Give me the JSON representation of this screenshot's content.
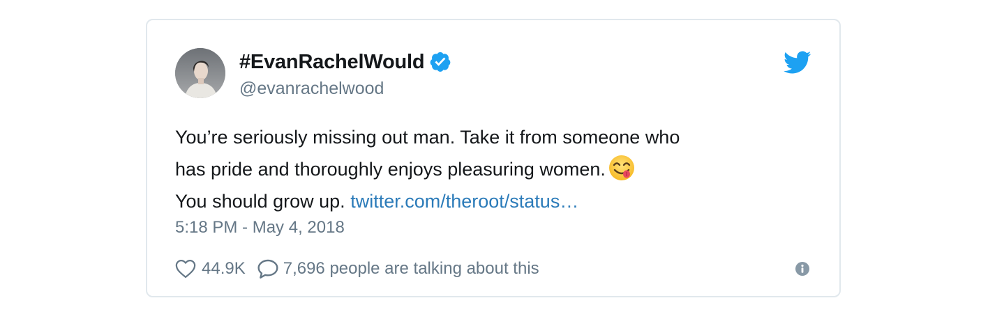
{
  "tweet": {
    "display_name": "#EvanRachelWould",
    "handle": "@evanrachelwood",
    "verified": true,
    "text_line1": "You’re seriously missing out man. Take it from someone who",
    "text_line2": "has pride and thoroughly enjoys pleasuring women.",
    "text_line3": "You should grow up.",
    "link_text": "twitter.com/theroot/status…",
    "timestamp": "5:18 PM - May 4, 2018",
    "likes": "44.9K",
    "talking": "7,696 people are talking about this"
  },
  "icons": {
    "verified": "verified-badge-icon",
    "brand": "twitter-bird-icon",
    "emoji": "face-savoring-food-emoji",
    "like": "heart-icon",
    "reply": "speech-bubble-icon",
    "info": "info-icon"
  },
  "colors": {
    "twitter_blue": "#1da1f2",
    "link": "#2b7bb9",
    "text": "#14171a",
    "secondary_text": "#657786",
    "border": "#e1e8ed"
  }
}
